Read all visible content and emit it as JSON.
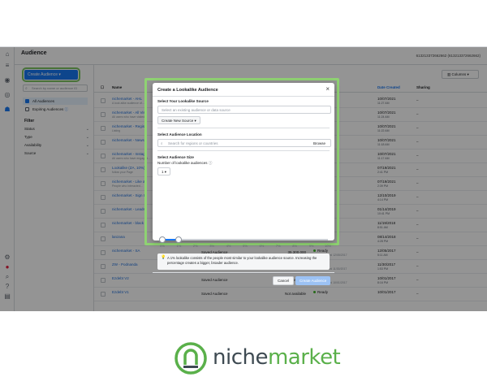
{
  "header": {
    "title": "Audience",
    "account": "613213372662662 (613213372662662)"
  },
  "left_panel": {
    "create_button": "Create Audience",
    "search_placeholder": "Search by name or audience ID",
    "filter_items": [
      {
        "label": "All Audiences",
        "active": true
      },
      {
        "label": "Expiring Audiences",
        "active": false
      }
    ],
    "filter_heading": "Filter",
    "filters": [
      "Status",
      "Type",
      "Availability",
      "Source"
    ]
  },
  "table": {
    "columns_button": "Columns",
    "headers": {
      "name": "Name",
      "date": "Date Created",
      "sharing": "Sharing"
    },
    "rows": [
      {
        "name": "nichemarket - AHL",
        "sub": "A look alike audience of...",
        "type": "",
        "size": "",
        "availability": "",
        "availability_sub": "",
        "date": "10/07/2021",
        "time": "11:27 AM",
        "sharing": "–"
      },
      {
        "name": "nichemarket - All Vis",
        "sub": "All users who have visited...",
        "type": "",
        "size": "",
        "availability": "",
        "availability_sub": "",
        "date": "10/07/2021",
        "time": "11:24 AM",
        "sharing": "–"
      },
      {
        "name": "nichemarket - Regist",
        "sub": "Listing",
        "type": "",
        "size": "",
        "availability": "",
        "availability_sub": "",
        "date": "10/07/2021",
        "time": "11:22 AM",
        "sharing": "–"
      },
      {
        "name": "nichemarket - Newsl",
        "sub": "",
        "type": "",
        "size": "",
        "availability": "",
        "availability_sub": "",
        "date": "10/07/2021",
        "time": "11:18 AM",
        "sharing": "–"
      },
      {
        "name": "nichemarket - Instag",
        "sub": "All users who have engaged...",
        "type": "",
        "size": "",
        "availability": "",
        "availability_sub": "",
        "date": "10/07/2021",
        "time": "11:17 AM",
        "sharing": "–"
      },
      {
        "name": "Lookalike (ZA, 10%)",
        "sub": "follow your Page",
        "type": "",
        "size": "",
        "availability": "",
        "availability_sub": "",
        "date": "07/19/2021",
        "time": "2:41 PM",
        "sharing": "–"
      },
      {
        "name": "nichemarket - Like a",
        "sub": "People who interacted...",
        "type": "",
        "size": "",
        "availability": "",
        "availability_sub": "",
        "date": "07/19/2021",
        "time": "2:39 PM",
        "sharing": "–"
      },
      {
        "name": "nichemarket - Sign U",
        "sub": "",
        "type": "",
        "size": "",
        "availability": "",
        "availability_sub": "",
        "date": "12/10/2019",
        "time": "4:14 PM",
        "sharing": "–"
      },
      {
        "name": "nichemarket - Leads",
        "sub": "",
        "type": "",
        "size": "",
        "availability": "",
        "availability_sub": "",
        "date": "01/14/2019",
        "time": "10:41 PM",
        "sharing": "–"
      },
      {
        "name": "nichemarket - black",
        "sub": "",
        "type": "",
        "size": "",
        "availability": "",
        "availability_sub": "",
        "date": "11/19/2018",
        "time": "8:51 AM",
        "sharing": "–"
      },
      {
        "name": "lanzana",
        "sub": "",
        "type": "Saved Audience",
        "size": "",
        "availability": "",
        "availability_sub": "",
        "date": "08/14/2018",
        "time": "4:28 PM",
        "sharing": "–"
      },
      {
        "name": "nichemarket - SA",
        "sub": "",
        "type": "Saved Audience",
        "size": "35,300,000",
        "availability": "Ready",
        "availability_sub": "Last edited 12/05/2017",
        "date": "12/05/2017",
        "time": "5:11 AM",
        "sharing": "–"
      },
      {
        "name": "ZW - Podnanda",
        "sub": "",
        "type": "Saved Audience",
        "size": "537,600",
        "availability": "Ready",
        "availability_sub": "Last edited 11/30/2017",
        "date": "11/30/2017",
        "time": "1:53 PM",
        "sharing": "–"
      },
      {
        "name": "Ezdebt V2",
        "sub": "",
        "type": "Saved Audience",
        "size": "Not available",
        "availability": "Ready",
        "availability_sub": "Last edited 10/01/2017",
        "date": "10/01/2017",
        "time": "8:16 PM",
        "sharing": "–"
      },
      {
        "name": "Ezdebt V1",
        "sub": "",
        "type": "Saved Audience",
        "size": "Not available",
        "availability": "Ready",
        "availability_sub": "",
        "date": "10/01/2017",
        "time": "",
        "sharing": "–"
      }
    ]
  },
  "modal": {
    "title": "Create a Lookalike Audience",
    "source_label": "Select Your Lookalike Source",
    "source_placeholder": "Select an existing audience or data source",
    "create_new_source": "Create New Source",
    "location_label": "Select Audience Location",
    "location_placeholder": "Search for regions or countries",
    "browse": "Browse",
    "size_label": "Select Audience Size",
    "count_label": "Number of lookalike audiences",
    "count_value": "1",
    "slider_ticks": [
      "0%",
      "1%",
      "2%",
      "3%",
      "4%",
      "5%",
      "6%",
      "7%",
      "8%",
      "9%",
      "10%"
    ],
    "slider_value_percent": 1,
    "info_text": "A 1% lookalike consists of the people most similar to your lookalike audience source. Increasing the percentage creates a bigger, broader audience.",
    "cancel": "Cancel",
    "create": "Create Audience"
  },
  "logo": {
    "part1": "niche",
    "part2": "market"
  },
  "colors": {
    "accent": "#1877f2",
    "highlight": "#8fd272",
    "brand_green": "#5ab04a",
    "brand_gray": "#3e4a52"
  }
}
